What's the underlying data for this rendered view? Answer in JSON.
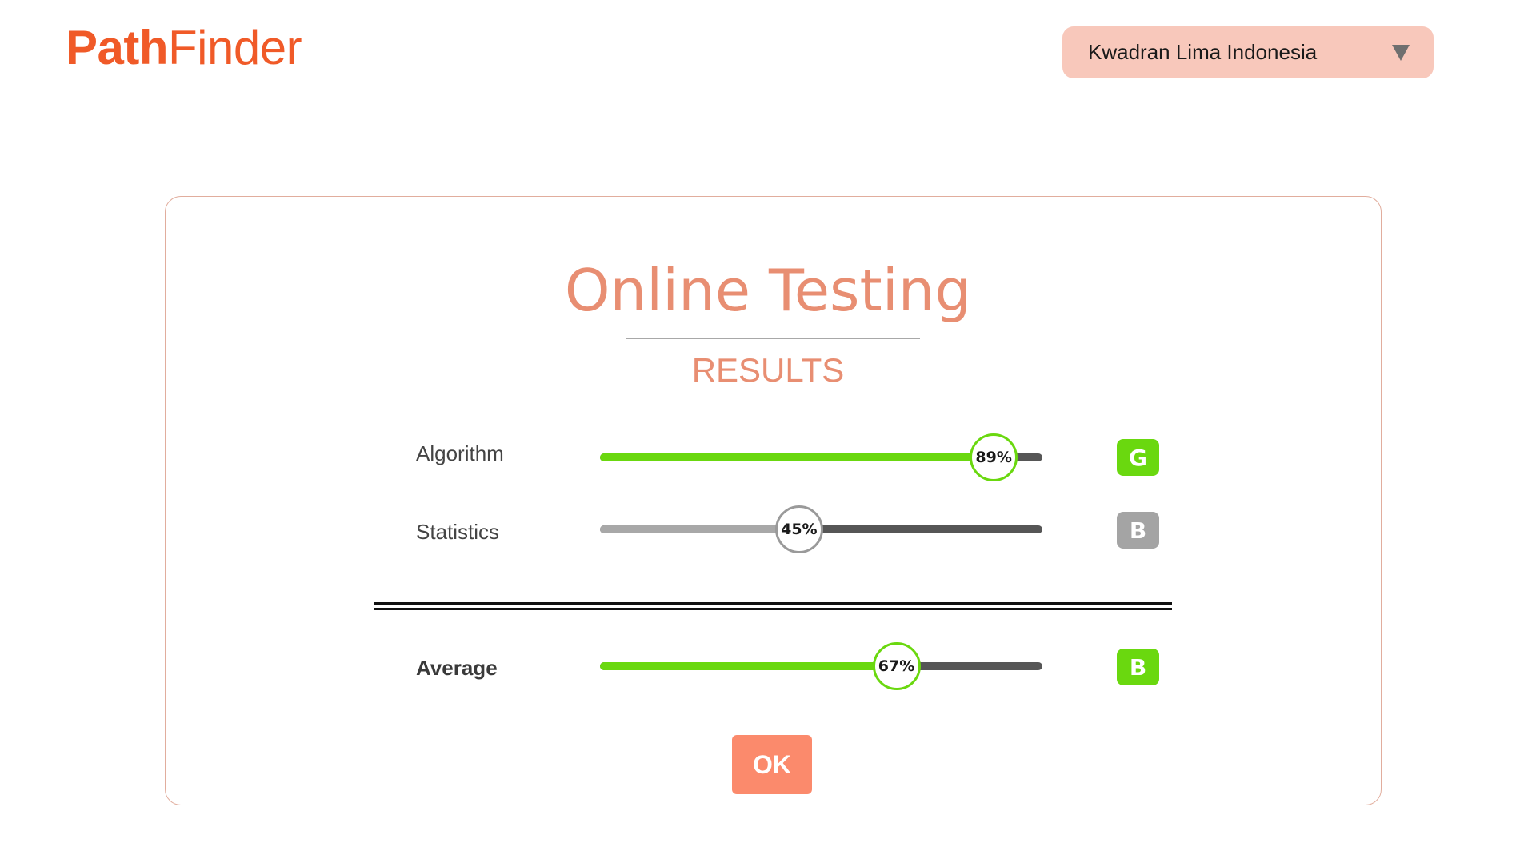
{
  "header": {
    "logo": {
      "part_a": "Path",
      "part_b": "Finder"
    },
    "org_select": {
      "value": "Kwadran Lima Indonesia"
    }
  },
  "card": {
    "title": "Online Testing",
    "subtitle": "RESULTS",
    "rows": [
      {
        "label": "Algorithm",
        "percent": 89,
        "percent_text": "89%",
        "grade": "G",
        "status": "pass"
      },
      {
        "label": "Statistics",
        "percent": 45,
        "percent_text": "45%",
        "grade": "B",
        "status": "neutral"
      }
    ],
    "average": {
      "label": "Average",
      "percent": 67,
      "percent_text": "67%",
      "grade": "B",
      "status": "pass"
    },
    "ok_label": "OK"
  },
  "colors": {
    "brand": "#f05a28",
    "title": "#e88e72",
    "dropdown_bg": "#f8c8bb",
    "pass": "#6ad80f",
    "neutral_fill": "#a8a8a8",
    "neutral_knob": "#9a9a9a",
    "neutral_badge": "#a4a4a4",
    "track": "#565656",
    "button": "#fb8a6c"
  },
  "icons": {
    "dropdown": "caret-down-icon"
  }
}
